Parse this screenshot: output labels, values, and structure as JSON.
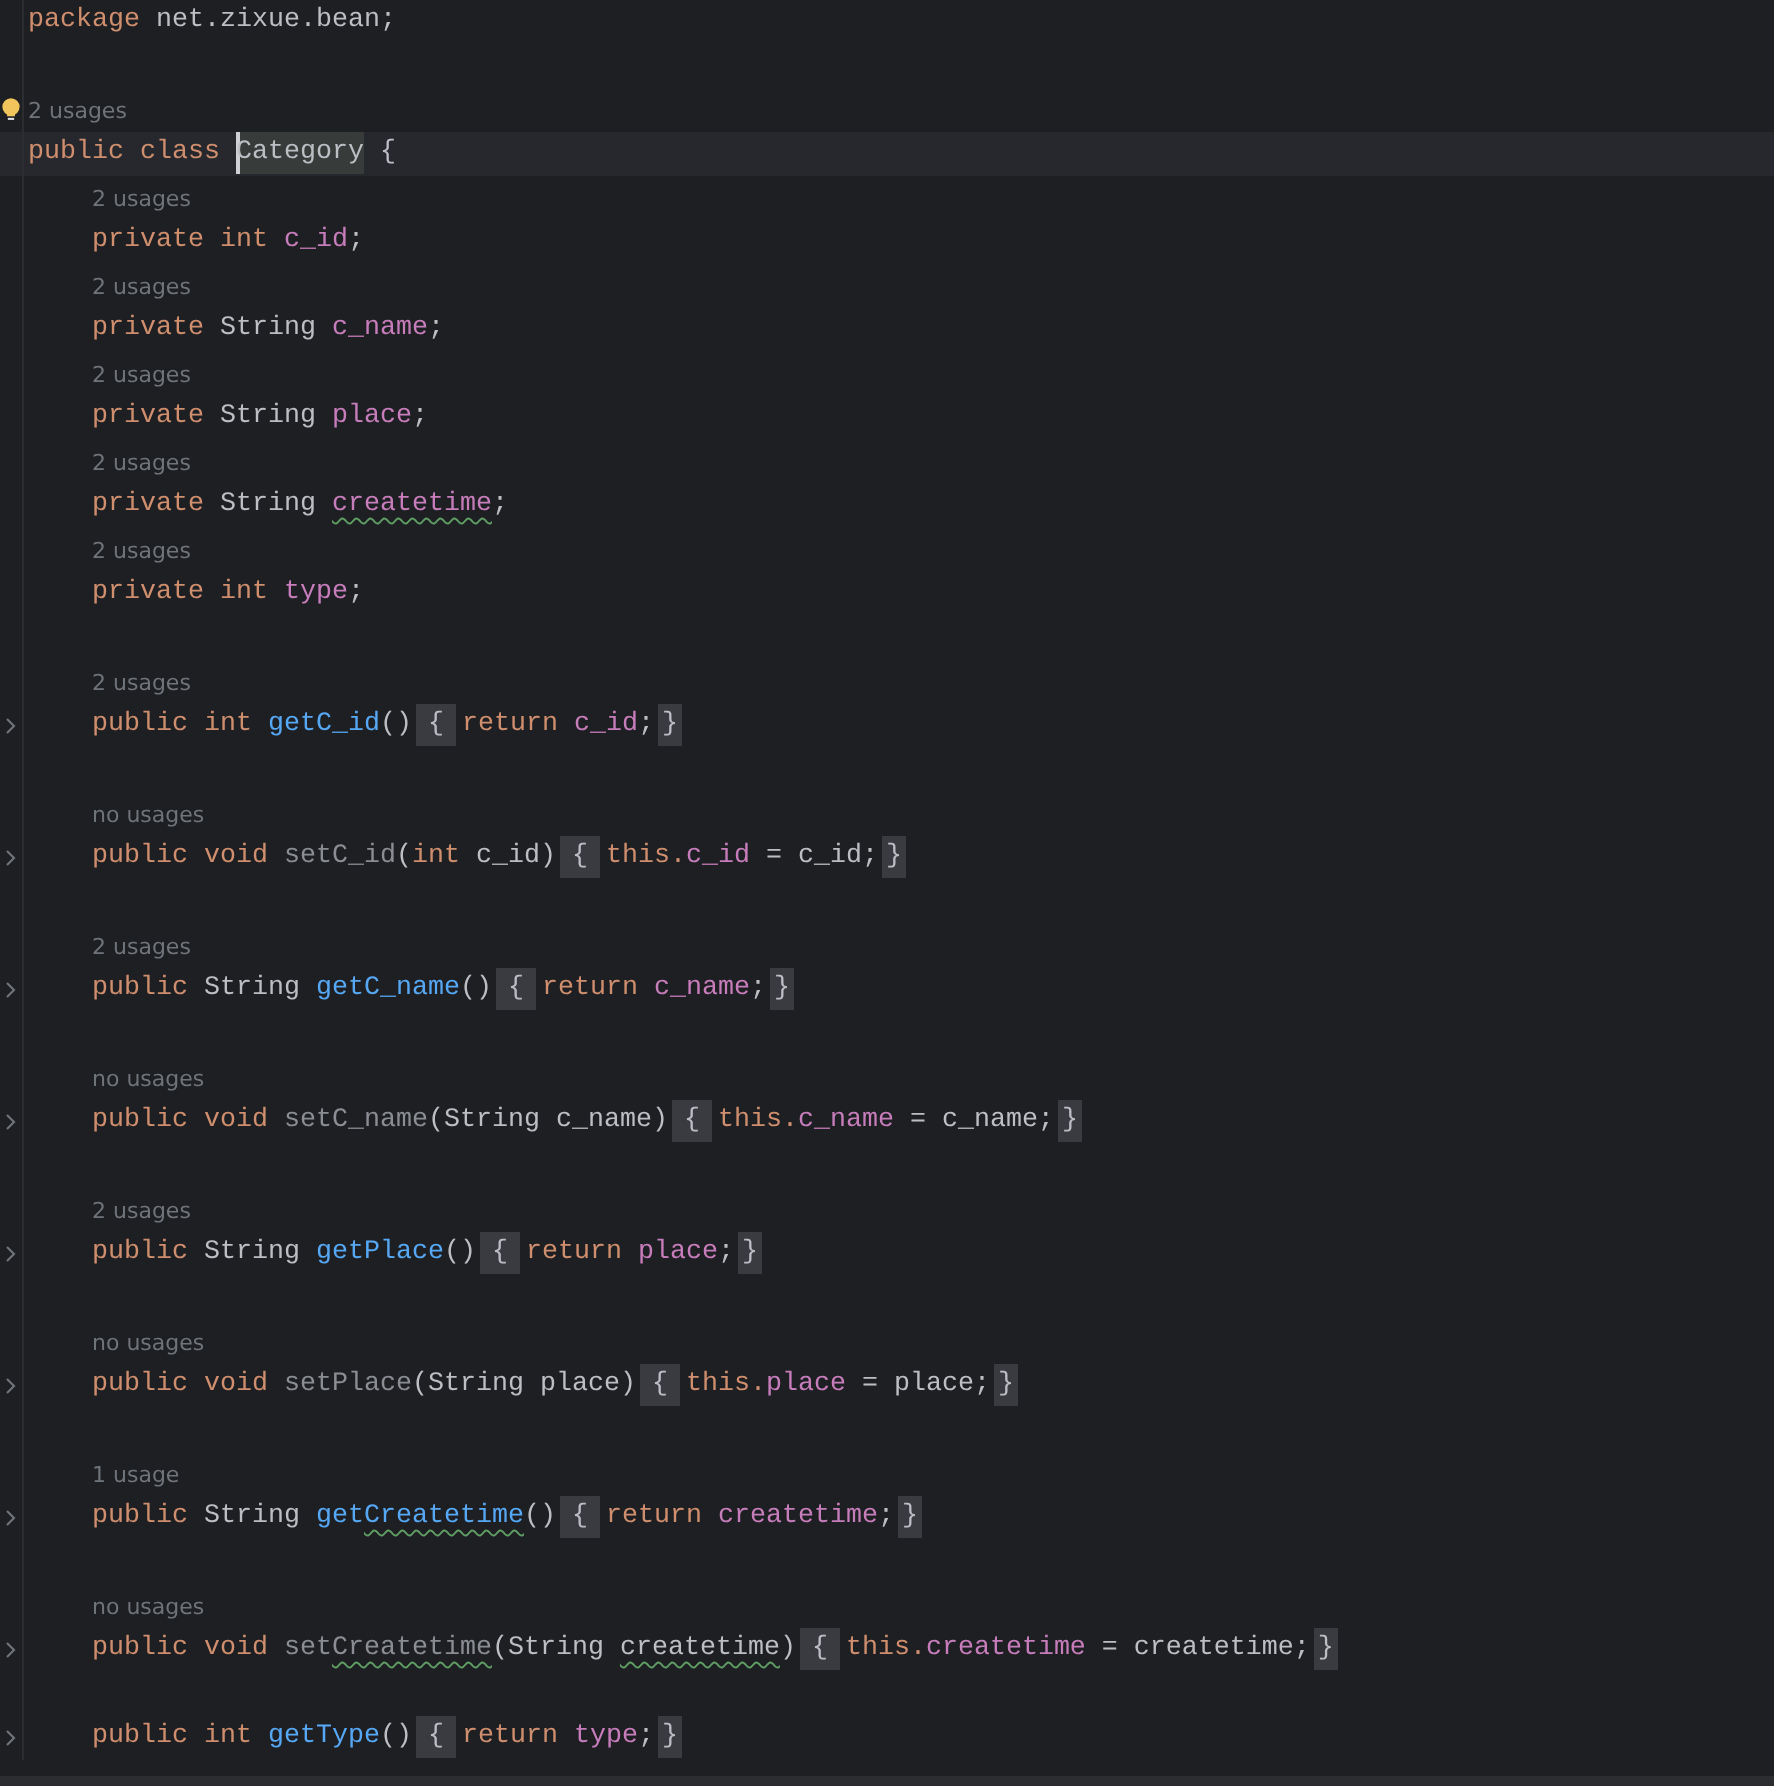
{
  "editor": {
    "lines": [
      {
        "kind": "code",
        "tokens": [
          {
            "text": "package ",
            "kind": "keyword"
          },
          {
            "text": "net.zixue.bean;",
            "kind": "plain"
          }
        ]
      },
      {
        "kind": "blank"
      },
      {
        "kind": "hint",
        "text": "2 usages",
        "intention_bulb": true
      },
      {
        "kind": "code",
        "current": true,
        "tokens": [
          {
            "text": "public class ",
            "kind": "keyword"
          },
          {
            "text": "Category",
            "kind": "plain",
            "caret": true
          },
          {
            "text": " {",
            "kind": "plain"
          }
        ],
        "children": [
          {
            "kind": "hint",
            "text": "2 usages"
          },
          {
            "kind": "code",
            "tokens": [
              {
                "text": "private int ",
                "kind": "keyword"
              },
              {
                "text": "c_id",
                "kind": "field"
              },
              {
                "text": ";",
                "kind": "plain"
              }
            ]
          },
          {
            "kind": "hint",
            "text": "2 usages"
          },
          {
            "kind": "code",
            "tokens": [
              {
                "text": "private ",
                "kind": "keyword"
              },
              {
                "text": "String ",
                "kind": "plain"
              },
              {
                "text": "c_name",
                "kind": "field"
              },
              {
                "text": ";",
                "kind": "plain"
              }
            ]
          },
          {
            "kind": "hint",
            "text": "2 usages"
          },
          {
            "kind": "code",
            "tokens": [
              {
                "text": "private ",
                "kind": "keyword"
              },
              {
                "text": "String ",
                "kind": "plain"
              },
              {
                "text": "place",
                "kind": "field"
              },
              {
                "text": ";",
                "kind": "plain"
              }
            ]
          },
          {
            "kind": "hint",
            "text": "2 usages"
          },
          {
            "kind": "code",
            "tokens": [
              {
                "text": "private ",
                "kind": "keyword"
              },
              {
                "text": "String ",
                "kind": "plain"
              },
              {
                "text": "createtime",
                "kind": "field",
                "warning": true
              },
              {
                "text": ";",
                "kind": "plain"
              }
            ]
          },
          {
            "kind": "hint",
            "text": "2 usages"
          },
          {
            "kind": "code",
            "tokens": [
              {
                "text": "private int ",
                "kind": "keyword"
              },
              {
                "text": "type",
                "kind": "field"
              },
              {
                "text": ";",
                "kind": "plain"
              }
            ]
          },
          {
            "kind": "blank"
          },
          {
            "kind": "hint",
            "text": "2 usages"
          },
          {
            "kind": "code",
            "folded": true,
            "tokens": [
              {
                "text": "public int ",
                "kind": "keyword"
              },
              {
                "text": "getC_id",
                "kind": "method"
              },
              {
                "text": "()",
                "kind": "plain"
              },
              {
                "text": "{",
                "kind": "fold_open"
              },
              {
                "text": "return ",
                "kind": "keyword"
              },
              {
                "text": "c_id",
                "kind": "field"
              },
              {
                "text": ";",
                "kind": "plain"
              },
              {
                "text": "}",
                "kind": "fold_close"
              }
            ]
          },
          {
            "kind": "blank"
          },
          {
            "kind": "hint",
            "text": "no usages"
          },
          {
            "kind": "code",
            "folded": true,
            "tokens": [
              {
                "text": "public void ",
                "kind": "keyword"
              },
              {
                "text": "setC_id",
                "kind": "unused_method"
              },
              {
                "text": "(",
                "kind": "plain"
              },
              {
                "text": "int ",
                "kind": "keyword"
              },
              {
                "text": "c_id)",
                "kind": "plain"
              },
              {
                "text": "{",
                "kind": "fold_open"
              },
              {
                "text": "this.",
                "kind": "keyword"
              },
              {
                "text": "c_id",
                "kind": "field"
              },
              {
                "text": " = c_id;",
                "kind": "plain"
              },
              {
                "text": "}",
                "kind": "fold_close"
              }
            ]
          },
          {
            "kind": "blank"
          },
          {
            "kind": "hint",
            "text": "2 usages"
          },
          {
            "kind": "code",
            "folded": true,
            "tokens": [
              {
                "text": "public ",
                "kind": "keyword"
              },
              {
                "text": "String ",
                "kind": "plain"
              },
              {
                "text": "getC_name",
                "kind": "method"
              },
              {
                "text": "()",
                "kind": "plain"
              },
              {
                "text": "{",
                "kind": "fold_open"
              },
              {
                "text": "return ",
                "kind": "keyword"
              },
              {
                "text": "c_name",
                "kind": "field"
              },
              {
                "text": ";",
                "kind": "plain"
              },
              {
                "text": "}",
                "kind": "fold_close"
              }
            ]
          },
          {
            "kind": "blank"
          },
          {
            "kind": "hint",
            "text": "no usages"
          },
          {
            "kind": "code",
            "folded": true,
            "tokens": [
              {
                "text": "public void ",
                "kind": "keyword"
              },
              {
                "text": "setC_name",
                "kind": "unused_method"
              },
              {
                "text": "(String c_name)",
                "kind": "plain"
              },
              {
                "text": "{",
                "kind": "fold_open"
              },
              {
                "text": "this.",
                "kind": "keyword"
              },
              {
                "text": "c_name",
                "kind": "field"
              },
              {
                "text": " = c_name;",
                "kind": "plain"
              },
              {
                "text": "}",
                "kind": "fold_close"
              }
            ]
          },
          {
            "kind": "blank"
          },
          {
            "kind": "hint",
            "text": "2 usages"
          },
          {
            "kind": "code",
            "folded": true,
            "tokens": [
              {
                "text": "public ",
                "kind": "keyword"
              },
              {
                "text": "String ",
                "kind": "plain"
              },
              {
                "text": "getPlace",
                "kind": "method"
              },
              {
                "text": "()",
                "kind": "plain"
              },
              {
                "text": "{",
                "kind": "fold_open"
              },
              {
                "text": "return ",
                "kind": "keyword"
              },
              {
                "text": "place",
                "kind": "field"
              },
              {
                "text": ";",
                "kind": "plain"
              },
              {
                "text": "}",
                "kind": "fold_close"
              }
            ]
          },
          {
            "kind": "blank"
          },
          {
            "kind": "hint",
            "text": "no usages"
          },
          {
            "kind": "code",
            "folded": true,
            "tokens": [
              {
                "text": "public void ",
                "kind": "keyword"
              },
              {
                "text": "setPlace",
                "kind": "unused_method"
              },
              {
                "text": "(String place)",
                "kind": "plain"
              },
              {
                "text": "{",
                "kind": "fold_open"
              },
              {
                "text": "this.",
                "kind": "keyword"
              },
              {
                "text": "place",
                "kind": "field"
              },
              {
                "text": " = place;",
                "kind": "plain"
              },
              {
                "text": "}",
                "kind": "fold_close"
              }
            ]
          },
          {
            "kind": "blank"
          },
          {
            "kind": "hint",
            "text": "1 usage"
          },
          {
            "kind": "code",
            "folded": true,
            "tokens": [
              {
                "text": "public ",
                "kind": "keyword"
              },
              {
                "text": "String ",
                "kind": "plain"
              },
              {
                "text": "get",
                "kind": "method"
              },
              {
                "text": "Createtime",
                "kind": "method",
                "warning": true
              },
              {
                "text": "()",
                "kind": "plain"
              },
              {
                "text": "{",
                "kind": "fold_open"
              },
              {
                "text": "return ",
                "kind": "keyword"
              },
              {
                "text": "createtime",
                "kind": "field"
              },
              {
                "text": ";",
                "kind": "plain"
              },
              {
                "text": "}",
                "kind": "fold_close"
              }
            ]
          },
          {
            "kind": "blank"
          },
          {
            "kind": "hint",
            "text": "no usages"
          },
          {
            "kind": "code",
            "folded": true,
            "tokens": [
              {
                "text": "public void ",
                "kind": "keyword"
              },
              {
                "text": "set",
                "kind": "unused_method"
              },
              {
                "text": "Createtime",
                "kind": "unused_method",
                "warning": true
              },
              {
                "text": "(String ",
                "kind": "plain"
              },
              {
                "text": "createtime",
                "kind": "plain",
                "warning": true
              },
              {
                "text": ")",
                "kind": "plain"
              },
              {
                "text": "{",
                "kind": "fold_open"
              },
              {
                "text": "this.",
                "kind": "keyword"
              },
              {
                "text": "createtime",
                "kind": "field"
              },
              {
                "text": " = createtime;",
                "kind": "plain"
              },
              {
                "text": "}",
                "kind": "fold_close"
              }
            ]
          },
          {
            "kind": "blank"
          },
          {
            "kind": "code",
            "folded": true,
            "tokens": [
              {
                "text": "public int ",
                "kind": "keyword"
              },
              {
                "text": "getType",
                "kind": "method"
              },
              {
                "text": "()",
                "kind": "plain"
              },
              {
                "text": "{",
                "kind": "fold_open"
              },
              {
                "text": "return ",
                "kind": "keyword"
              },
              {
                "text": "type",
                "kind": "field"
              },
              {
                "text": ";",
                "kind": "plain"
              },
              {
                "text": "}",
                "kind": "fold_close"
              }
            ]
          }
        ]
      }
    ]
  }
}
